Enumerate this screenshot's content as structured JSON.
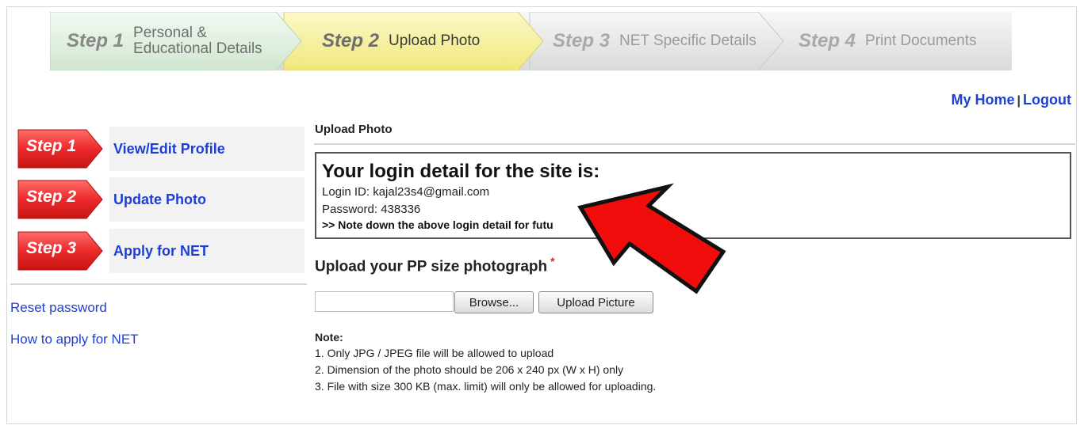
{
  "wizard": {
    "steps": [
      {
        "num": "Step 1",
        "label_line1": "Personal &",
        "label_line2": "Educational Details"
      },
      {
        "num": "Step 2",
        "label": "Upload Photo"
      },
      {
        "num": "Step 3",
        "label": "NET Specific Details"
      },
      {
        "num": "Step 4",
        "label": "Print Documents"
      }
    ],
    "colors": {
      "step1": "#dbeede",
      "step2": "#f6f2a2",
      "inactive": "#e6e6e6"
    }
  },
  "toplinks": {
    "home": "My Home",
    "separator": "|",
    "logout": "Logout"
  },
  "sidebar": {
    "steps": [
      {
        "badge": "Step 1",
        "label": "View/Edit Profile"
      },
      {
        "badge": "Step 2",
        "label": "Update Photo"
      },
      {
        "badge": "Step 3",
        "label": "Apply for NET"
      }
    ],
    "links": [
      "Reset password",
      "How to apply for NET"
    ]
  },
  "main": {
    "title": "Upload Photo",
    "login": {
      "heading": "Your login detail for the site is:",
      "login_id": "Login ID: kajal23s4@gmail.com",
      "password": "Password: 438336",
      "note": ">> Note down the above login detail for futu"
    },
    "upload": {
      "heading": "Upload your PP size photograph",
      "required_mark": "*",
      "file_value": "",
      "browse_label": "Browse...",
      "upload_label": "Upload Picture"
    },
    "notes": {
      "title": "Note:",
      "lines": [
        "1. Only JPG / JPEG file will be allowed to upload",
        "2. Dimension of the photo should be 206 x 240 px (W x H) only",
        "3. File with size 300 KB (max. limit) will only be allowed for uploading."
      ]
    }
  },
  "accent": {
    "link": "#1e3fd6",
    "badge_red": "#e8262a",
    "arrow_red": "#f20d0d"
  }
}
